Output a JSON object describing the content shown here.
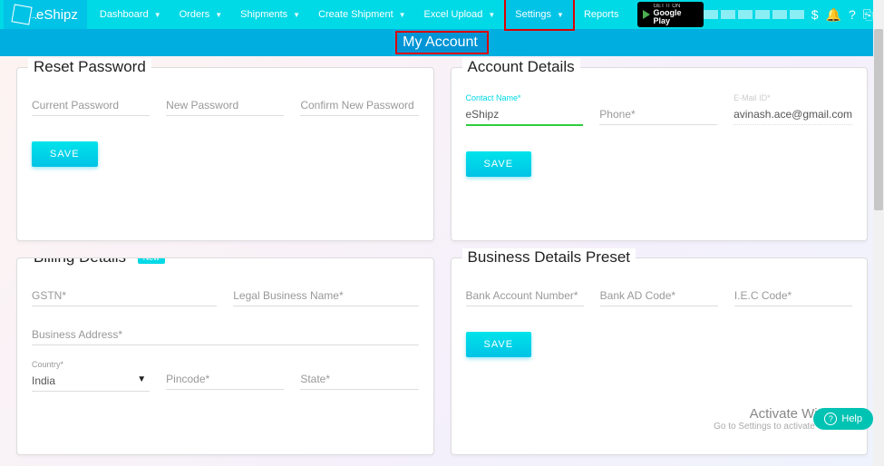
{
  "brand": "eShipz",
  "nav": {
    "dashboard": "Dashboard",
    "orders": "Orders",
    "shipments": "Shipments",
    "create": "Create Shipment",
    "excel": "Excel Upload",
    "settings": "Settings",
    "reports": "Reports",
    "gplay_small": "GET IT ON",
    "gplay_big": "Google Play"
  },
  "page_title": "My Account",
  "reset": {
    "title": "Reset Password",
    "current_ph": "Current Password",
    "new_ph": "New Password",
    "confirm_ph": "Confirm New Password",
    "save": "SAVE"
  },
  "account": {
    "title": "Account Details",
    "contact_label": "Contact Name*",
    "contact_value": "eShipz",
    "phone_ph": "Phone*",
    "email_label": "E-Mail ID*",
    "email_value": "avinash.ace@gmail.com",
    "save": "SAVE"
  },
  "billing": {
    "title": "Billing Details",
    "badge": "New",
    "gstn_ph": "GSTN*",
    "legal_ph": "Legal Business Name*",
    "address_ph": "Business Address*",
    "country_label": "Country*",
    "country_value": "India",
    "pincode_ph": "Pincode*",
    "state_ph": "State*"
  },
  "business": {
    "title": "Business Details Preset",
    "bank_ph": "Bank Account Number*",
    "ad_ph": "Bank AD Code*",
    "iec_ph": "I.E.C Code*",
    "save": "SAVE"
  },
  "watermark": {
    "line1": "Activate Windows",
    "line2": "Go to Settings to activate Windows."
  },
  "help": "Help"
}
